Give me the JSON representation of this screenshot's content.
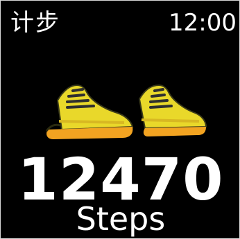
{
  "header": {
    "title": "计步",
    "time": "12:00"
  },
  "steps": {
    "value": "12470",
    "unit": "Steps"
  },
  "icon": {
    "name": "sneakers-icon"
  },
  "colors": {
    "background": "#000000",
    "text": "#ffffff",
    "shoe_body": "#e9d82a",
    "shoe_sole": "#f2a321",
    "shoe_dark": "#3a3a1a"
  }
}
